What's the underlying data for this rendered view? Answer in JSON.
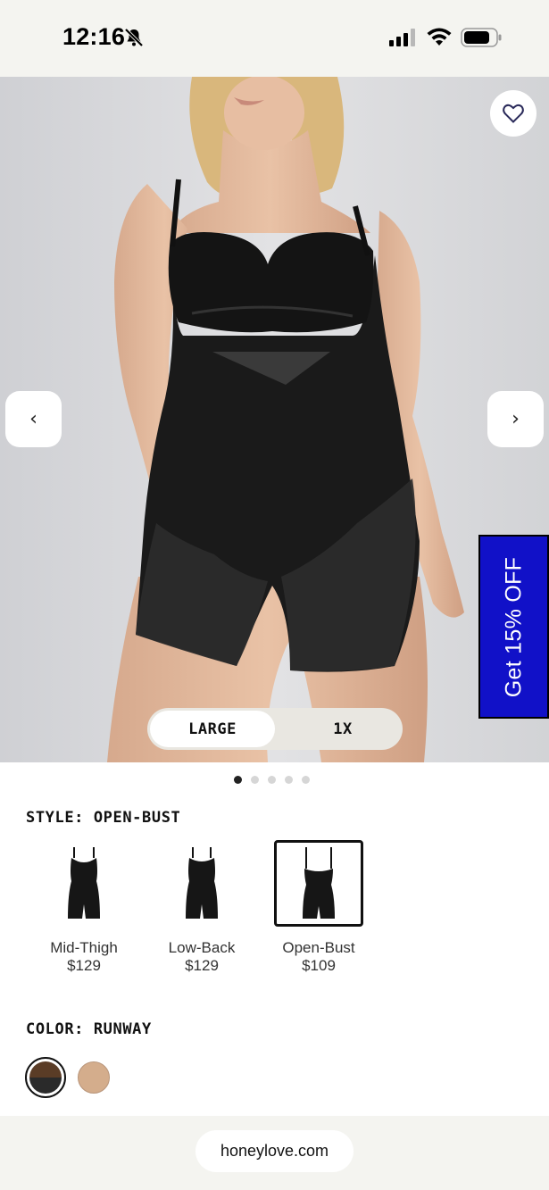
{
  "status_bar": {
    "time": "12:16"
  },
  "hero": {
    "size_options": [
      "LARGE",
      "1X"
    ],
    "selected_size": "LARGE",
    "promo": "Get 15% OFF",
    "image_count": 5,
    "active_image": 1,
    "prev_label": "‹",
    "next_label": "›"
  },
  "style": {
    "label": "STYLE: OPEN-BUST",
    "options": [
      {
        "name": "Mid-Thigh",
        "price": "$129",
        "selected": false
      },
      {
        "name": "Low-Back",
        "price": "$129",
        "selected": false
      },
      {
        "name": "Open-Bust",
        "price": "$109",
        "selected": true
      }
    ]
  },
  "color": {
    "label": "COLOR: RUNWAY",
    "swatches": [
      {
        "name": "runway",
        "colors": [
          "#5a3c26",
          "#2a2a2a"
        ],
        "selected": true
      },
      {
        "name": "nude",
        "colors": [
          "#d4ad8c"
        ],
        "selected": false
      }
    ]
  },
  "browser": {
    "url": "honeylove.com"
  },
  "colors": {
    "promo_bg": "#1111c8",
    "hero_bg": "#dedee0",
    "page_bg": "#f4f4f0"
  }
}
